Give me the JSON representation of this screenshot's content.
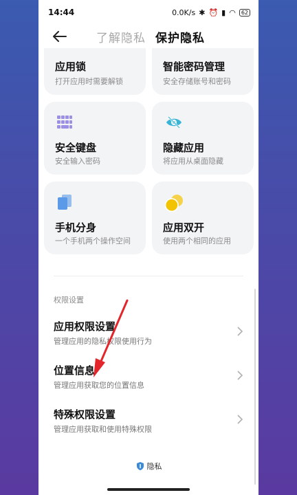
{
  "status": {
    "time": "14:44",
    "speed": "0.0K/s",
    "battery": "62"
  },
  "header": {
    "tab_inactive": "了解隐私",
    "tab_active": "保护隐私"
  },
  "cards": [
    {
      "title": "应用锁",
      "desc": "打开应用时需要解锁"
    },
    {
      "title": "智能密码管理",
      "desc": "安全存储账号和密码"
    },
    {
      "title": "安全键盘",
      "desc": "安全输入密码",
      "icon": "keypad-icon"
    },
    {
      "title": "隐藏应用",
      "desc": "将应用从桌面隐藏",
      "icon": "eye-hidden-icon"
    },
    {
      "title": "手机分身",
      "desc": "一个手机两个操作空间",
      "icon": "dual-phone-icon"
    },
    {
      "title": "应用双开",
      "desc": "使用两个相同的应用",
      "icon": "dual-app-icon"
    }
  ],
  "permissions": {
    "section_label": "权限设置",
    "items": [
      {
        "title": "应用权限设置",
        "desc": "管理应用的隐私权限使用行为"
      },
      {
        "title": "位置信息",
        "desc": "管理应用获取您的位置信息"
      },
      {
        "title": "特殊权限设置",
        "desc": "管理应用获取和使用特殊权限"
      }
    ]
  },
  "footer": {
    "label": "隐私"
  },
  "colors": {
    "keypad": "#9b8fe6",
    "eye": "#39b3d6",
    "dual_phone": "#5b9ae8",
    "dual_app": "#f2c300",
    "arrow": "#e3262b"
  }
}
